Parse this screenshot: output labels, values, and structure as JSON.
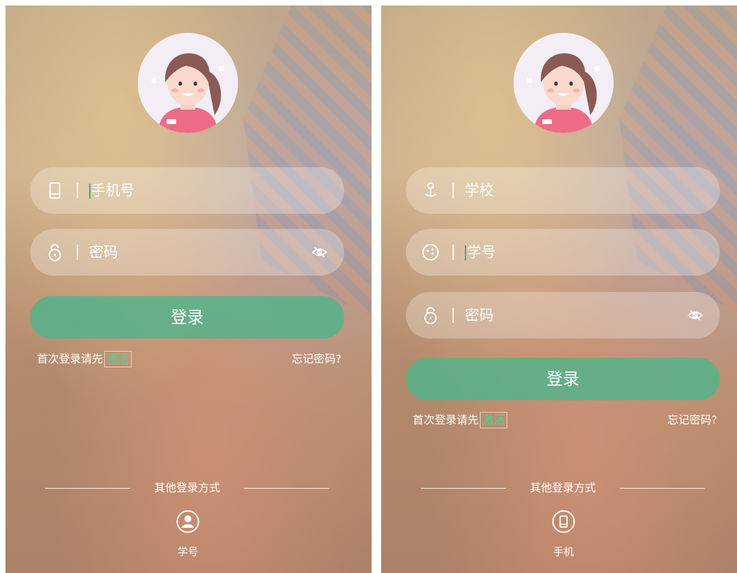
{
  "left_screen": {
    "phone_placeholder": "手机号",
    "password_placeholder": "密码",
    "login_label": "登录",
    "first_login_text": "首次登录请先",
    "activate_link": "激活",
    "forgot_password": "忘记密码?",
    "other_methods": "其他登录方式",
    "alt_method_label": "学号"
  },
  "right_screen": {
    "school_placeholder": "学校",
    "student_id_placeholder": "学号",
    "password_placeholder": "密码",
    "login_label": "登录",
    "first_login_text": "首次登录请先",
    "activate_link": "激活",
    "forgot_password": "忘记密码?",
    "other_methods": "其他登录方式",
    "alt_method_label": "手机"
  },
  "icons": {
    "phone": "phone-icon",
    "lock": "lock-icon",
    "eye": "eye-hidden-icon",
    "school": "school-icon",
    "face": "face-icon",
    "user": "user-icon"
  },
  "colors": {
    "accent_green": "#58b28a",
    "activate_green": "#4cd39a",
    "field_background": "rgba(255,255,255,0.28)"
  }
}
